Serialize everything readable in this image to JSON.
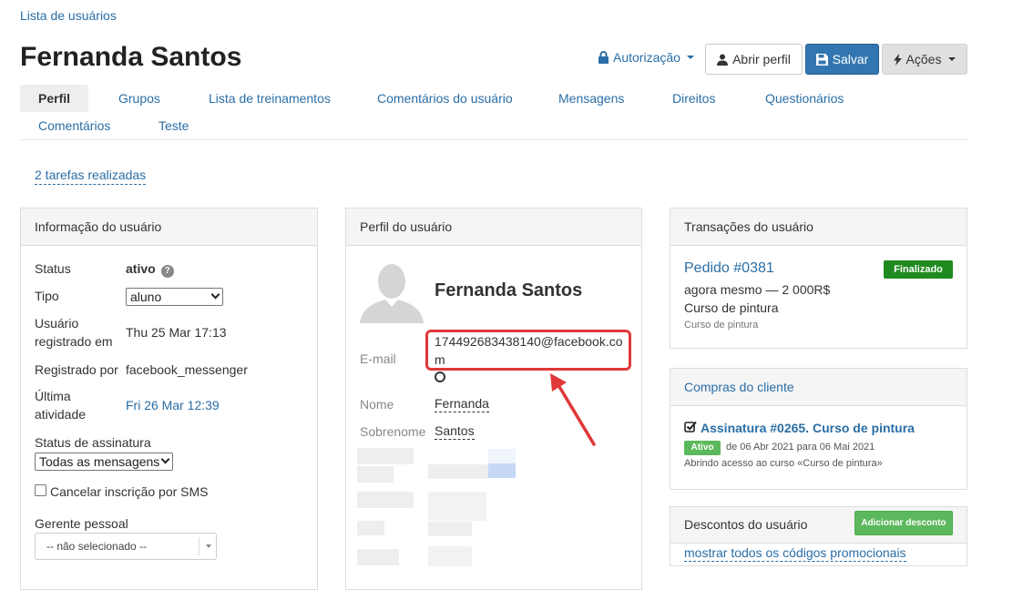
{
  "breadcrumb": "Lista de usuários",
  "page_title": "Fernanda Santos",
  "header": {
    "auth_label": "Autorização",
    "open_profile_label": "Abrir perfil",
    "save_label": "Salvar",
    "actions_label": "Ações"
  },
  "tabs": [
    {
      "label": "Perfil",
      "active": true
    },
    {
      "label": "Grupos"
    },
    {
      "label": "Lista de treinamentos"
    },
    {
      "label": "Comentários do usuário"
    },
    {
      "label": "Mensagens"
    },
    {
      "label": "Direitos"
    },
    {
      "label": "Questionários"
    },
    {
      "label": "Comentários"
    },
    {
      "label": "Teste"
    }
  ],
  "tasks_link": "2 tarefas realizadas",
  "user_info": {
    "title": "Informação do usuário",
    "status_label": "Status",
    "status_value": "ativo",
    "type_label": "Tipo",
    "type_value": "aluno",
    "registered_label_1": "Usuário",
    "registered_label_2": "registrado em",
    "registered_value": "Thu 25 Mar 17:13",
    "registered_by_label": "Registrado por",
    "registered_by_value": "facebook_messenger",
    "last_activity_label_1": "Última",
    "last_activity_label_2": "atividade",
    "last_activity_value": "Fri 26 Mar 12:39",
    "subscription_label": "Status de assinatura",
    "subscription_value": "Todas as mensagens",
    "sms_label": "Cancelar inscrição por SMS",
    "manager_label": "Gerente pessoal",
    "manager_value": "-- não selecionado --"
  },
  "profile": {
    "title": "Perfil do usuário",
    "name": "Fernanda Santos",
    "email_label": "E-mail",
    "email_line1": "174492683438140@facebook.co",
    "email_line2": "m",
    "first_name_label": "Nome",
    "first_name_value": "Fernanda",
    "last_name_label": "Sobrenome",
    "last_name_value": "Santos"
  },
  "transactions": {
    "title": "Transações do usuário",
    "order": "Pedido #0381",
    "status": "Finalizado",
    "time_amount": "agora mesmo — 2 000R$",
    "course": "Curso de pintura",
    "course_small": "Curso de pintura"
  },
  "purchases": {
    "title": "Compras do cliente",
    "subscription": "Assinatura #0265. Curso de pintura",
    "active_badge": "Ativo",
    "period": "de 06 Abr 2021 para 06 Mai 2021",
    "access": "Abrindo acesso ao curso «Curso de pintura»"
  },
  "discounts": {
    "title": "Descontos do usuário",
    "add_label": "Adicionar desconto",
    "promo_link": "mostrar todos os códigos promocionais"
  },
  "colors": {
    "link": "#2a6ea6",
    "save_button": "#3276b1",
    "success": "#5cb85c",
    "finished_badge": "#1f8a1f",
    "highlight": "#e03838"
  }
}
